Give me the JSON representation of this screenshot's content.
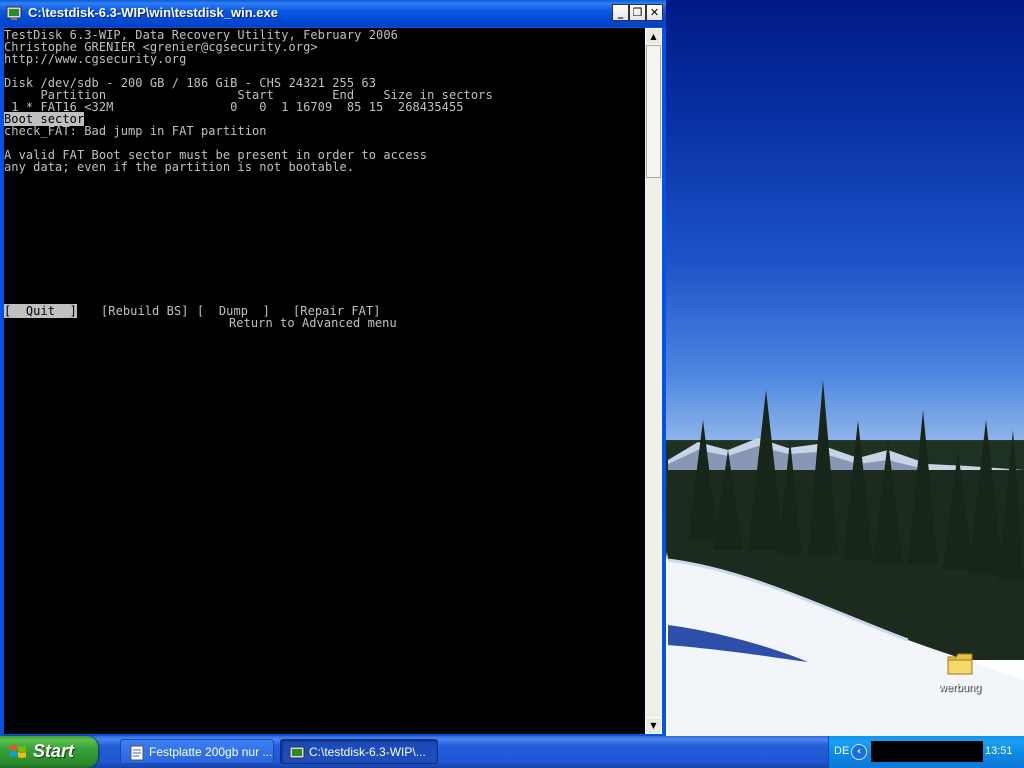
{
  "window": {
    "title": "C:\\testdisk-6.3-WIP\\win\\testdisk_win.exe",
    "minimize": "_",
    "restore": "❐",
    "close": "✕"
  },
  "console": {
    "lines": [
      "TestDisk 6.3-WIP, Data Recovery Utility, February 2006",
      "Christophe GRENIER <grenier@cgsecurity.org>",
      "http://www.cgsecurity.org",
      "",
      "Disk /dev/sdb - 200 GB / 186 GiB - CHS 24321 255 63",
      "     Partition                  Start        End    Size in sectors",
      " 1 * FAT16 <32M                0   0  1 16709  85 15  268435455"
    ],
    "boot_sector": "Boot sector",
    "check_line": "check_FAT: Bad jump in FAT partition",
    "valid_1": "A valid FAT Boot sector must be present in order to access",
    "valid_2": "any data; even if the partition is not bootable.",
    "menu": {
      "quit": "[  Quit  ]",
      "rebuild_bs": "[Rebuild BS]",
      "dump": "[  Dump  ]",
      "repair_fat": "[Repair FAT]"
    },
    "help": "Return to Advanced menu"
  },
  "scrollbar": {
    "up": "▲",
    "down": "▼"
  },
  "desktop_icon": {
    "label": "werbung",
    "icon": "folder-icon"
  },
  "taskbar": {
    "start": "Start",
    "items": [
      {
        "label": "Festplatte 200gb nur ...",
        "icon": "document-icon"
      },
      {
        "label": "C:\\testdisk-6.3-WIP\\...",
        "icon": "console-icon"
      }
    ],
    "lang": "DE",
    "expand": "‹",
    "clock": "13:51"
  }
}
